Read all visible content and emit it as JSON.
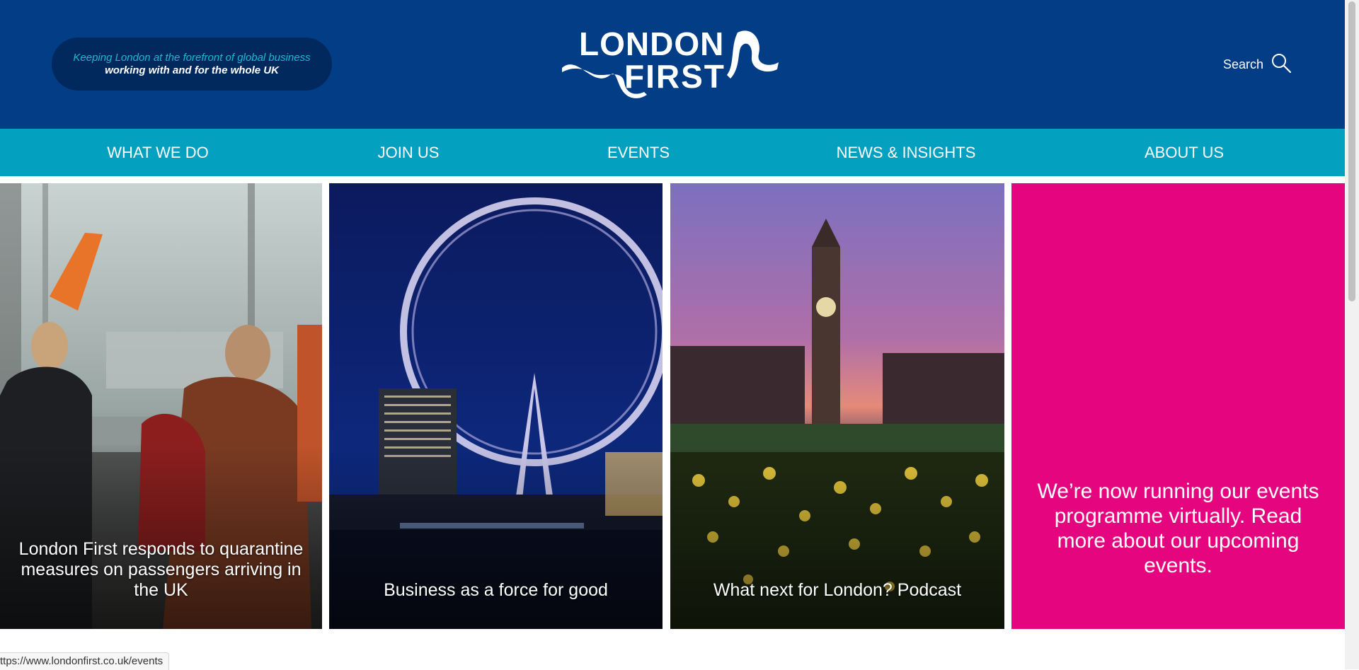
{
  "header": {
    "tagline_line1": "Keeping London at the forefront of global business",
    "tagline_line2": "working with and for the whole UK",
    "logo_line1": "LONDON",
    "logo_line2": "FIRST",
    "search_label": "Search",
    "colors": {
      "background": "#033d86",
      "tagline_bg": "#02295d",
      "accent": "#1fb6d4"
    }
  },
  "nav": {
    "items": [
      {
        "label": "WHAT WE DO"
      },
      {
        "label": "JOIN US"
      },
      {
        "label": "EVENTS"
      },
      {
        "label": "NEWS & INSIGHTS"
      },
      {
        "label": "ABOUT US"
      }
    ],
    "color": "#04a0c0"
  },
  "tiles": [
    {
      "caption": "London First responds to quarantine measures on passengers arriving in the UK",
      "image": "airport-passengers-photo"
    },
    {
      "caption": "Business as a force for good",
      "image": "london-eye-night-photo"
    },
    {
      "caption": "What next for London? Podcast",
      "image": "big-ben-sunset-daffodils-photo"
    },
    {
      "text": "We’re now running our events programme virtually. Read more about our upcoming events.",
      "color": "#e5057f"
    }
  ],
  "status_bar": {
    "url": "ttps://www.londonfirst.co.uk/events"
  }
}
